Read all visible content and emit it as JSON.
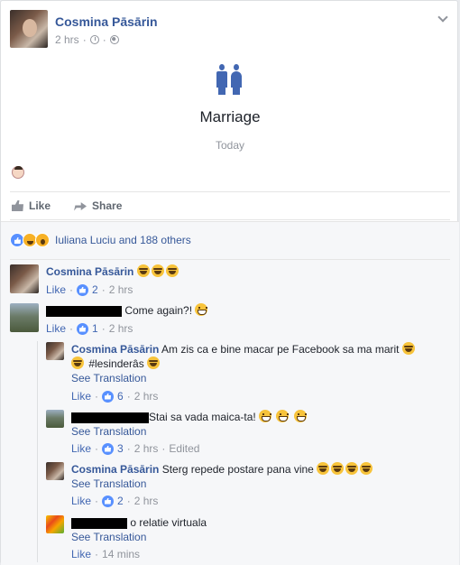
{
  "post": {
    "author": "Cosmina Pāsārin",
    "time": "2 hrs",
    "event_title": "Marriage",
    "event_date": "Today"
  },
  "actions": {
    "like": "Like",
    "share": "Share"
  },
  "reactions": {
    "text": "Iuliana Luciu and 188 others"
  },
  "comments": [
    {
      "name": "Cosmina Pāsārin",
      "text": "",
      "like": "Like",
      "likes": "2",
      "time": "2 hrs"
    },
    {
      "name": "",
      "text": "Come again?!",
      "like": "Like",
      "likes": "1",
      "time": "2 hrs"
    }
  ],
  "replies": [
    {
      "name": "Cosmina Pāsārin",
      "text": "Am zis ca e bine macar pe Facebook sa ma marit",
      "text2": "#lesinderâs",
      "see": "See Translation",
      "like": "Like",
      "likes": "6",
      "time": "2 hrs"
    },
    {
      "name": "",
      "text": "Stai sa vada maica-ta!",
      "see": "See Translation",
      "like": "Like",
      "likes": "3",
      "time": "2 hrs",
      "edited": "Edited"
    },
    {
      "name": "Cosmina Pāsārin",
      "text": "Sterg repede postare pana vine",
      "see": "See Translation",
      "like": "Like",
      "likes": "2",
      "time": "2 hrs"
    },
    {
      "name": "",
      "text": "o relatie virtuala",
      "see": "See Translation",
      "like": "Like",
      "time": "14 mins"
    }
  ],
  "icons": {
    "clock": "clock-icon",
    "globe": "globe-icon",
    "chevron": "chevron-down-icon",
    "life_event": "couple-icon",
    "like": "thumb-icon",
    "share": "share-icon"
  },
  "colors": {
    "link": "#365899",
    "accent": "#4267b2",
    "muted": "#90949c"
  }
}
